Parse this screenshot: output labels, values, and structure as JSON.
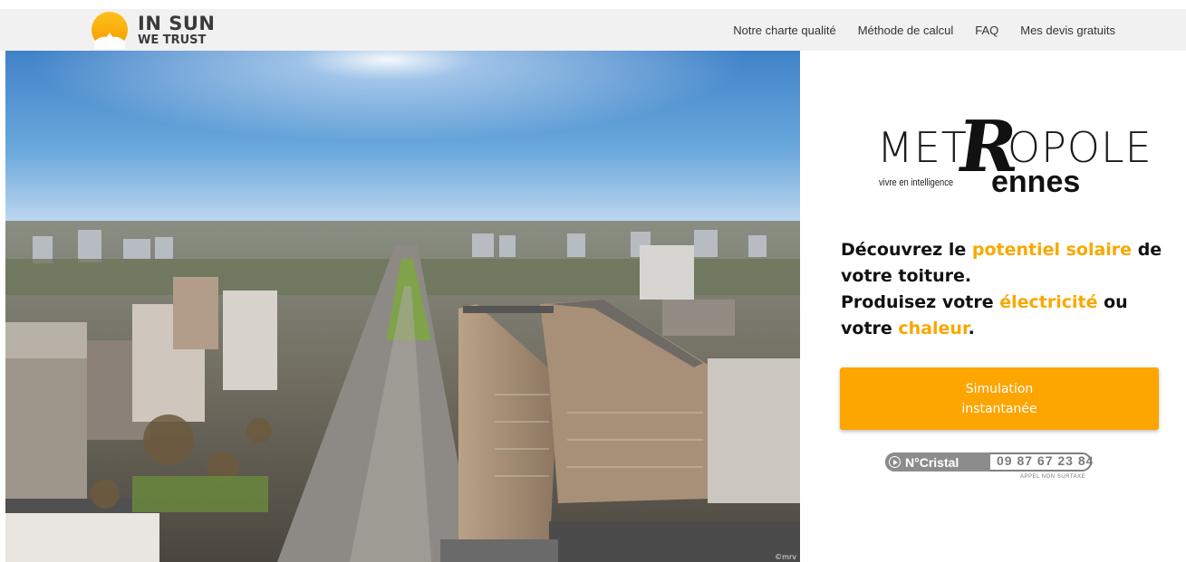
{
  "header": {
    "logo_line1": "IN SUN",
    "logo_line2": "WE TRUST",
    "nav": [
      {
        "label": "Notre charte qualité"
      },
      {
        "label": "Méthode de calcul"
      },
      {
        "label": "FAQ"
      },
      {
        "label": "Mes devis gratuits"
      }
    ]
  },
  "hero": {
    "credit": "©mrv"
  },
  "partner_logo": {
    "word_left": "MET",
    "word_r": "R",
    "word_right": "OPOLE",
    "tagline": "vivre en intelligence",
    "city": "ennes"
  },
  "headline": {
    "part1": "Découvrez le ",
    "highlight1": "potentiel solaire",
    "part2": " de votre toiture.",
    "part3": "Produisez votre ",
    "highlight2": "électricité",
    "part4": " ou votre ",
    "highlight3": "chaleur",
    "part5": "."
  },
  "cta": {
    "label": "Simulation instantanée"
  },
  "cristal": {
    "label": "N°Cristal",
    "number": "09 87 67 23 84",
    "note": "APPEL NON SURTAXE"
  },
  "colors": {
    "accent": "#fda500",
    "highlight_text": "#f8a800",
    "header_bg": "#f1f1f1"
  }
}
